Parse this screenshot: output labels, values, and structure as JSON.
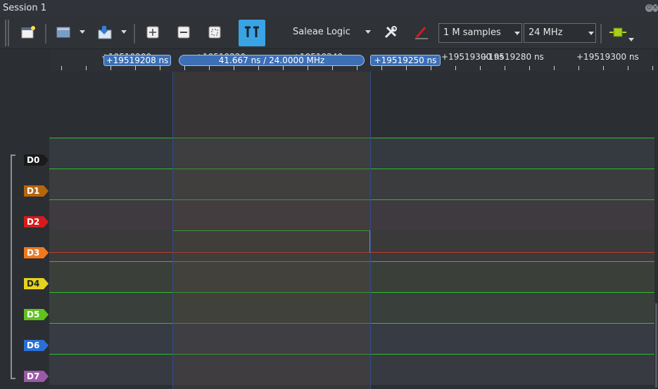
{
  "window": {
    "title": "Session 1"
  },
  "toolbar": {
    "device_name": "Saleae Logic",
    "samples_value": "1 M samples",
    "rate_value": "24 MHz",
    "icons": [
      "new-session-icon",
      "open-icon",
      "save-icon",
      "zoom-in-icon",
      "zoom-out-icon",
      "zoom-fit-icon",
      "cursor-mode-icon",
      "settings-icon",
      "trigger-icon",
      "analyzer-plugin-icon"
    ]
  },
  "ruler": {
    "labels": [
      "+19519200",
      "+19519220",
      "+19519240",
      "+19519280 ns",
      "+19519300 ns"
    ],
    "ns_fragment": "ns"
  },
  "markers": {
    "left": "+19519208 ns",
    "span": "41.667 ns / 24.0000 MHz",
    "right": "+19519250 ns"
  },
  "channels": [
    {
      "name": "D0",
      "color": "#1a1a1a"
    },
    {
      "name": "D1",
      "color": "#b5660d"
    },
    {
      "name": "D2",
      "color": "#d41c1c"
    },
    {
      "name": "D3",
      "color": "#f0781e"
    },
    {
      "name": "D4",
      "color": "#e6d21e"
    },
    {
      "name": "D5",
      "color": "#5fc21e"
    },
    {
      "name": "D6",
      "color": "#2a6fd6"
    },
    {
      "name": "D7",
      "color": "#9a5aa6"
    }
  ]
}
